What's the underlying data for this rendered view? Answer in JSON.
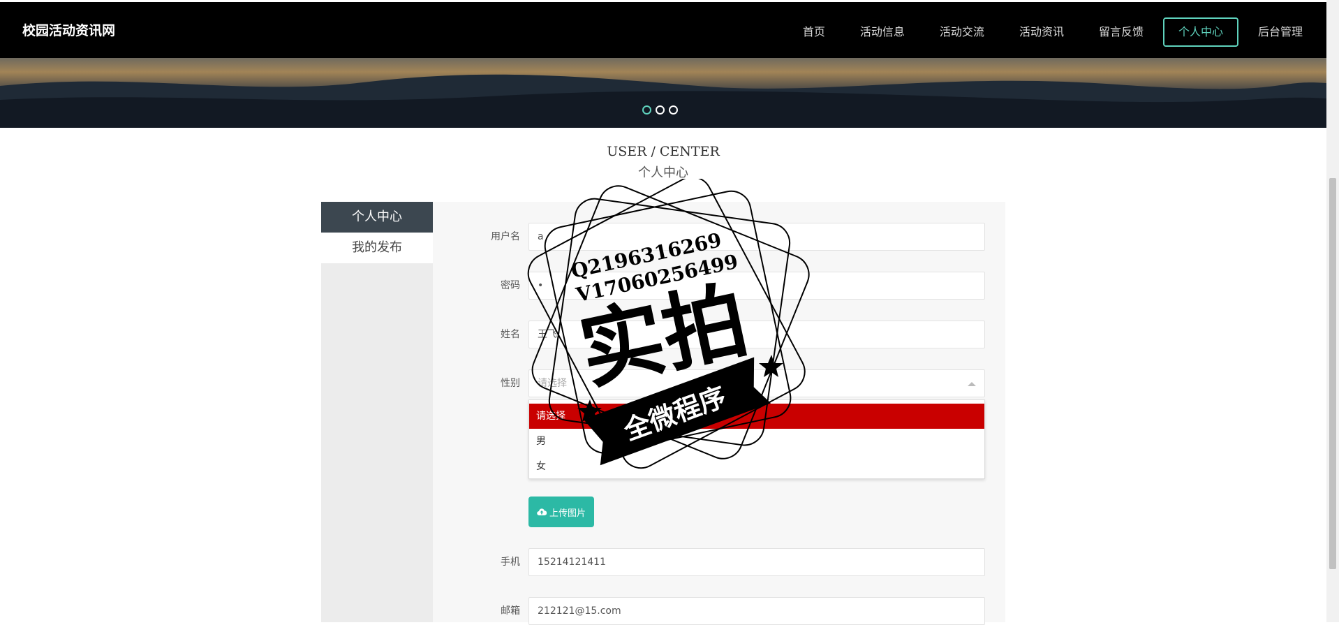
{
  "brand": "校园活动资讯网",
  "nav": [
    {
      "label": "首页",
      "active": false
    },
    {
      "label": "活动信息",
      "active": false
    },
    {
      "label": "活动交流",
      "active": false
    },
    {
      "label": "活动资讯",
      "active": false
    },
    {
      "label": "留言反馈",
      "active": false
    },
    {
      "label": "个人中心",
      "active": true
    },
    {
      "label": "后台管理",
      "active": false
    }
  ],
  "section": {
    "title_en": "USER / CENTER",
    "title_cn": "个人中心"
  },
  "sidebar": {
    "items": [
      {
        "label": "个人中心"
      },
      {
        "label": "我的发布"
      }
    ]
  },
  "form": {
    "username": {
      "label": "用户名",
      "value": "a"
    },
    "password": {
      "label": "密码",
      "value": "•"
    },
    "name": {
      "label": "姓名",
      "value": "王飞"
    },
    "gender": {
      "label": "性别",
      "placeholder": "请选择",
      "options": [
        "请选择",
        "男",
        "女"
      ]
    },
    "upload": {
      "label": "上传图片"
    },
    "phone": {
      "label": "手机",
      "value": "15214121411"
    },
    "email": {
      "label": "邮箱",
      "value": "212121@15.com"
    }
  },
  "watermark": {
    "qq": "Q2196316269",
    "vx": "V17060256499",
    "main": "实拍",
    "ribbon": "全微程序"
  },
  "colors": {
    "accent": "#5fd2bd",
    "upload": "#2cb9a5",
    "selected_option": "#c90000",
    "sidebar_active": "#3c4750"
  }
}
